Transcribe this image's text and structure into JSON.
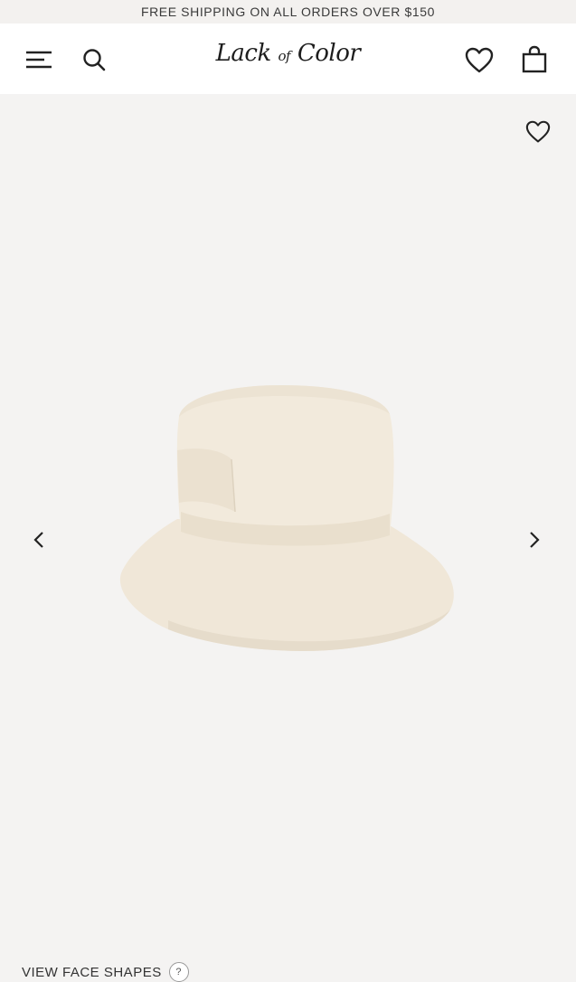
{
  "promo": {
    "text": "FREE SHIPPING ON ALL ORDERS OVER $150"
  },
  "header": {
    "logo_main1": "Lack ",
    "logo_small": "of",
    "logo_main2": " Color",
    "icons": [
      "menu-icon",
      "search-icon",
      "heart-icon",
      "bag-icon"
    ]
  },
  "gallery": {
    "icons": [
      "heart-icon",
      "chevron-left-icon",
      "chevron-right-icon"
    ]
  },
  "footer": {
    "face_shapes": "VIEW FACE SHAPES",
    "help": "?"
  },
  "colors": {
    "background": "#f4f3f2",
    "hat": "#efe6d6",
    "text": "#222222"
  }
}
